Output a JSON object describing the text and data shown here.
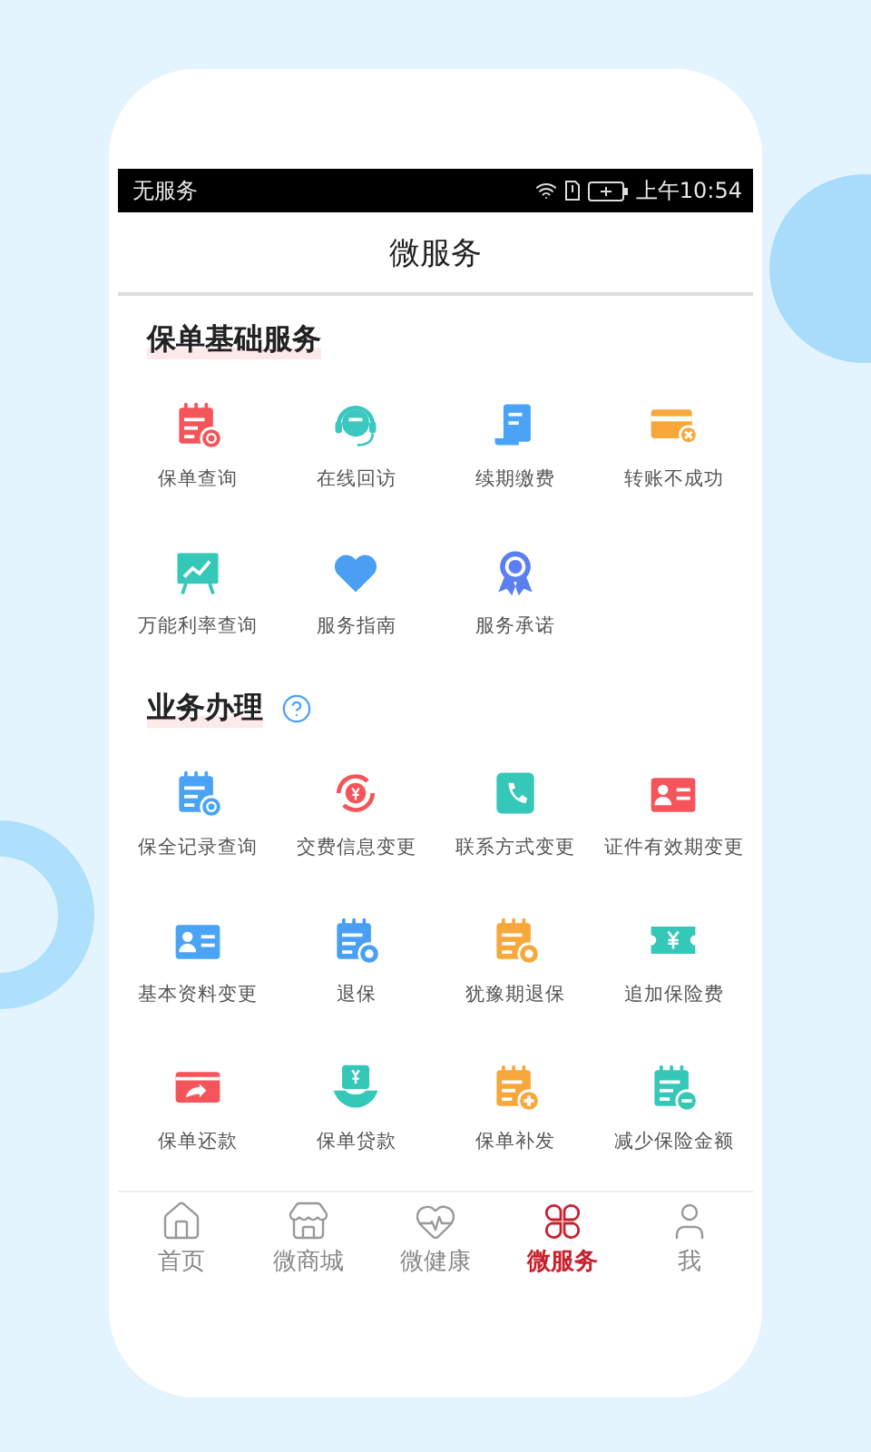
{
  "status_bar": {
    "carrier": "无服务",
    "time": "上午10:54"
  },
  "header": {
    "title": "微服务"
  },
  "sections": [
    {
      "title": "保单基础服务",
      "help": false,
      "items": [
        {
          "label": "保单查询",
          "color": "#f4555b"
        },
        {
          "label": "在线回访",
          "color": "#3cc8c0"
        },
        {
          "label": "续期缴费",
          "color": "#4aa3f5"
        },
        {
          "label": "转账不成功",
          "color": "#f8a83b"
        },
        {
          "label": "万能利率查询",
          "color": "#35c7b7"
        },
        {
          "label": "服务指南",
          "color": "#4a9ff5"
        },
        {
          "label": "服务承诺",
          "color": "#5b7ff0"
        }
      ]
    },
    {
      "title": "业务办理",
      "help": true,
      "items": [
        {
          "label": "保全记录查询",
          "color": "#4aa3f5"
        },
        {
          "label": "交费信息变更",
          "color": "#f4555b"
        },
        {
          "label": "联系方式变更",
          "color": "#35c7b7"
        },
        {
          "label": "证件有效期变更",
          "color": "#f4555b"
        },
        {
          "label": "基本资料变更",
          "color": "#4aa3f5"
        },
        {
          "label": "退保",
          "color": "#4a9ff5"
        },
        {
          "label": "犹豫期退保",
          "color": "#f8a83b"
        },
        {
          "label": "追加保险费",
          "color": "#35c7b7"
        },
        {
          "label": "保单还款",
          "color": "#f4555b"
        },
        {
          "label": "保单贷款",
          "color": "#35c7b7"
        },
        {
          "label": "保单补发",
          "color": "#f8a83b"
        },
        {
          "label": "减少保险金额",
          "color": "#35c7b7"
        }
      ]
    }
  ],
  "tab_bar": [
    {
      "label": "首页",
      "selected": false
    },
    {
      "label": "微商城",
      "selected": false
    },
    {
      "label": "微健康",
      "selected": false
    },
    {
      "label": "微服务",
      "selected": true
    },
    {
      "label": "我",
      "selected": false
    }
  ]
}
